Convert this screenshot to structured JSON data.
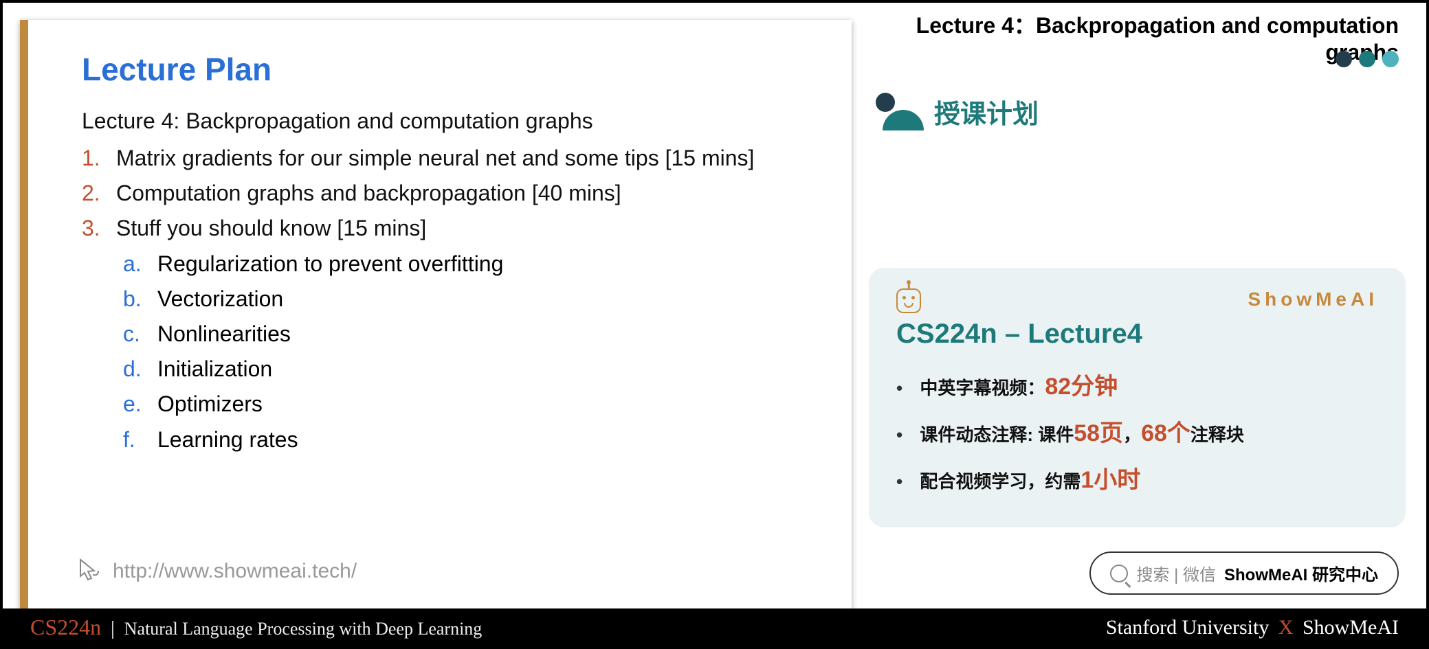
{
  "slide": {
    "title": "Lecture Plan",
    "lecture_line": "Lecture 4: Backpropagation and computation graphs",
    "items": [
      {
        "num": "1.",
        "text": "Matrix gradients for our simple neural net and some tips [15 mins]"
      },
      {
        "num": "2.",
        "text": "Computation graphs and backpropagation [40 mins]"
      },
      {
        "num": "3.",
        "text": "Stuff you should know [15 mins]"
      }
    ],
    "subitems": [
      {
        "letter": "a.",
        "text": "Regularization to prevent overfitting"
      },
      {
        "letter": "b.",
        "text": "Vectorization"
      },
      {
        "letter": "c.",
        "text": "Nonlinearities"
      },
      {
        "letter": "d.",
        "text": "Initialization"
      },
      {
        "letter": "e.",
        "text": "Optimizers"
      },
      {
        "letter": "f.",
        "text": "Learning rates"
      }
    ],
    "url": "http://www.showmeai.tech/"
  },
  "right": {
    "top_title": "Lecture 4：Backpropagation and computation graphs",
    "section_title": "授课计划",
    "brand": "ShowMeAI",
    "card_title": "CS224n – Lecture4",
    "bullet1_a": "中英字幕视频：",
    "bullet1_b": "82分钟",
    "bullet2_a": "课件动态注释: 课件",
    "bullet2_b": "58页",
    "bullet2_c": "，",
    "bullet2_d": "68个",
    "bullet2_e": "注释块",
    "bullet3_a": "配合视频学习，约需",
    "bullet3_b": "1小时",
    "search_label": "搜索 | 微信",
    "search_bold": "ShowMeAI 研究中心"
  },
  "footer": {
    "code": "CS224n",
    "pipe": "|",
    "course": "Natural Language Processing with Deep Learning",
    "uni": "Stanford University",
    "x": "X",
    "brand": "ShowMeAI"
  }
}
